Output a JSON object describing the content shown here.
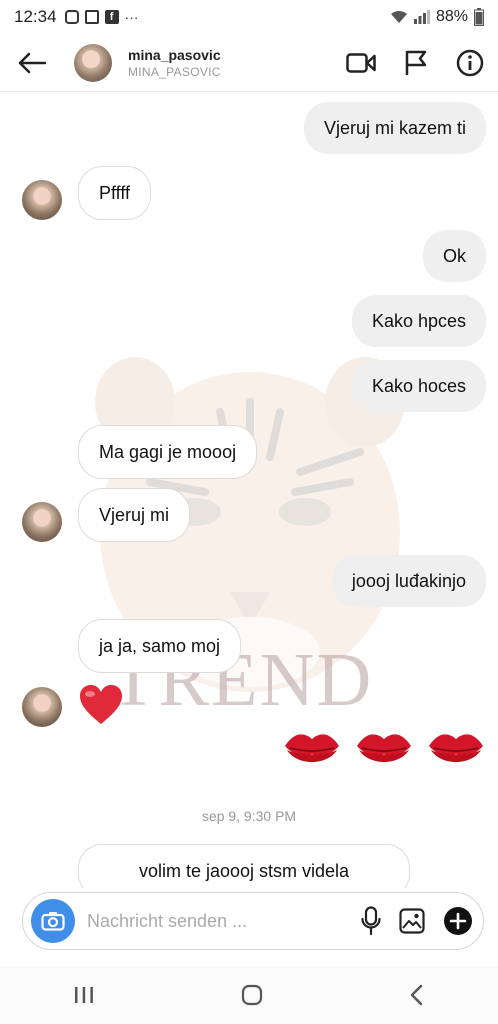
{
  "status": {
    "time": "12:34",
    "battery": "88%",
    "app_icons": [
      "instagram-icon",
      "gallery-icon",
      "facebook-icon",
      "more-icon"
    ]
  },
  "header": {
    "username": "mina_pasovic",
    "subtitle": "MINA_PASOVIC"
  },
  "messages": [
    {
      "side": "out",
      "text": "Vjeruj mi kazem ti"
    },
    {
      "side": "in",
      "text": "Pffff"
    },
    {
      "side": "out",
      "text": "Ok"
    },
    {
      "side": "out",
      "text": "Kako hpces"
    },
    {
      "side": "out",
      "text": "Kako hoces"
    },
    {
      "side": "in",
      "text": "Ma gagi je moooj"
    },
    {
      "side": "in",
      "text": "Vjeruj mi"
    },
    {
      "side": "out",
      "text": "joooj luđakinjo"
    },
    {
      "side": "in",
      "text": "ja ja, samo moj"
    },
    {
      "side": "in",
      "type": "emoji",
      "text": "heart"
    },
    {
      "side": "out",
      "type": "emoji",
      "text": "kiss-mark x3"
    },
    {
      "side": "in",
      "text": "volim te jaoooj stsm videla"
    }
  ],
  "timestamp": "sep 9, 9:30 PM",
  "watermark": "TREND",
  "composer": {
    "placeholder": "Nachricht senden ..."
  },
  "colors": {
    "outgoing_bubble": "#efefef",
    "camera_button": "#3f8ee8",
    "heart": "#e02a3a",
    "kiss": "#d4162a"
  }
}
